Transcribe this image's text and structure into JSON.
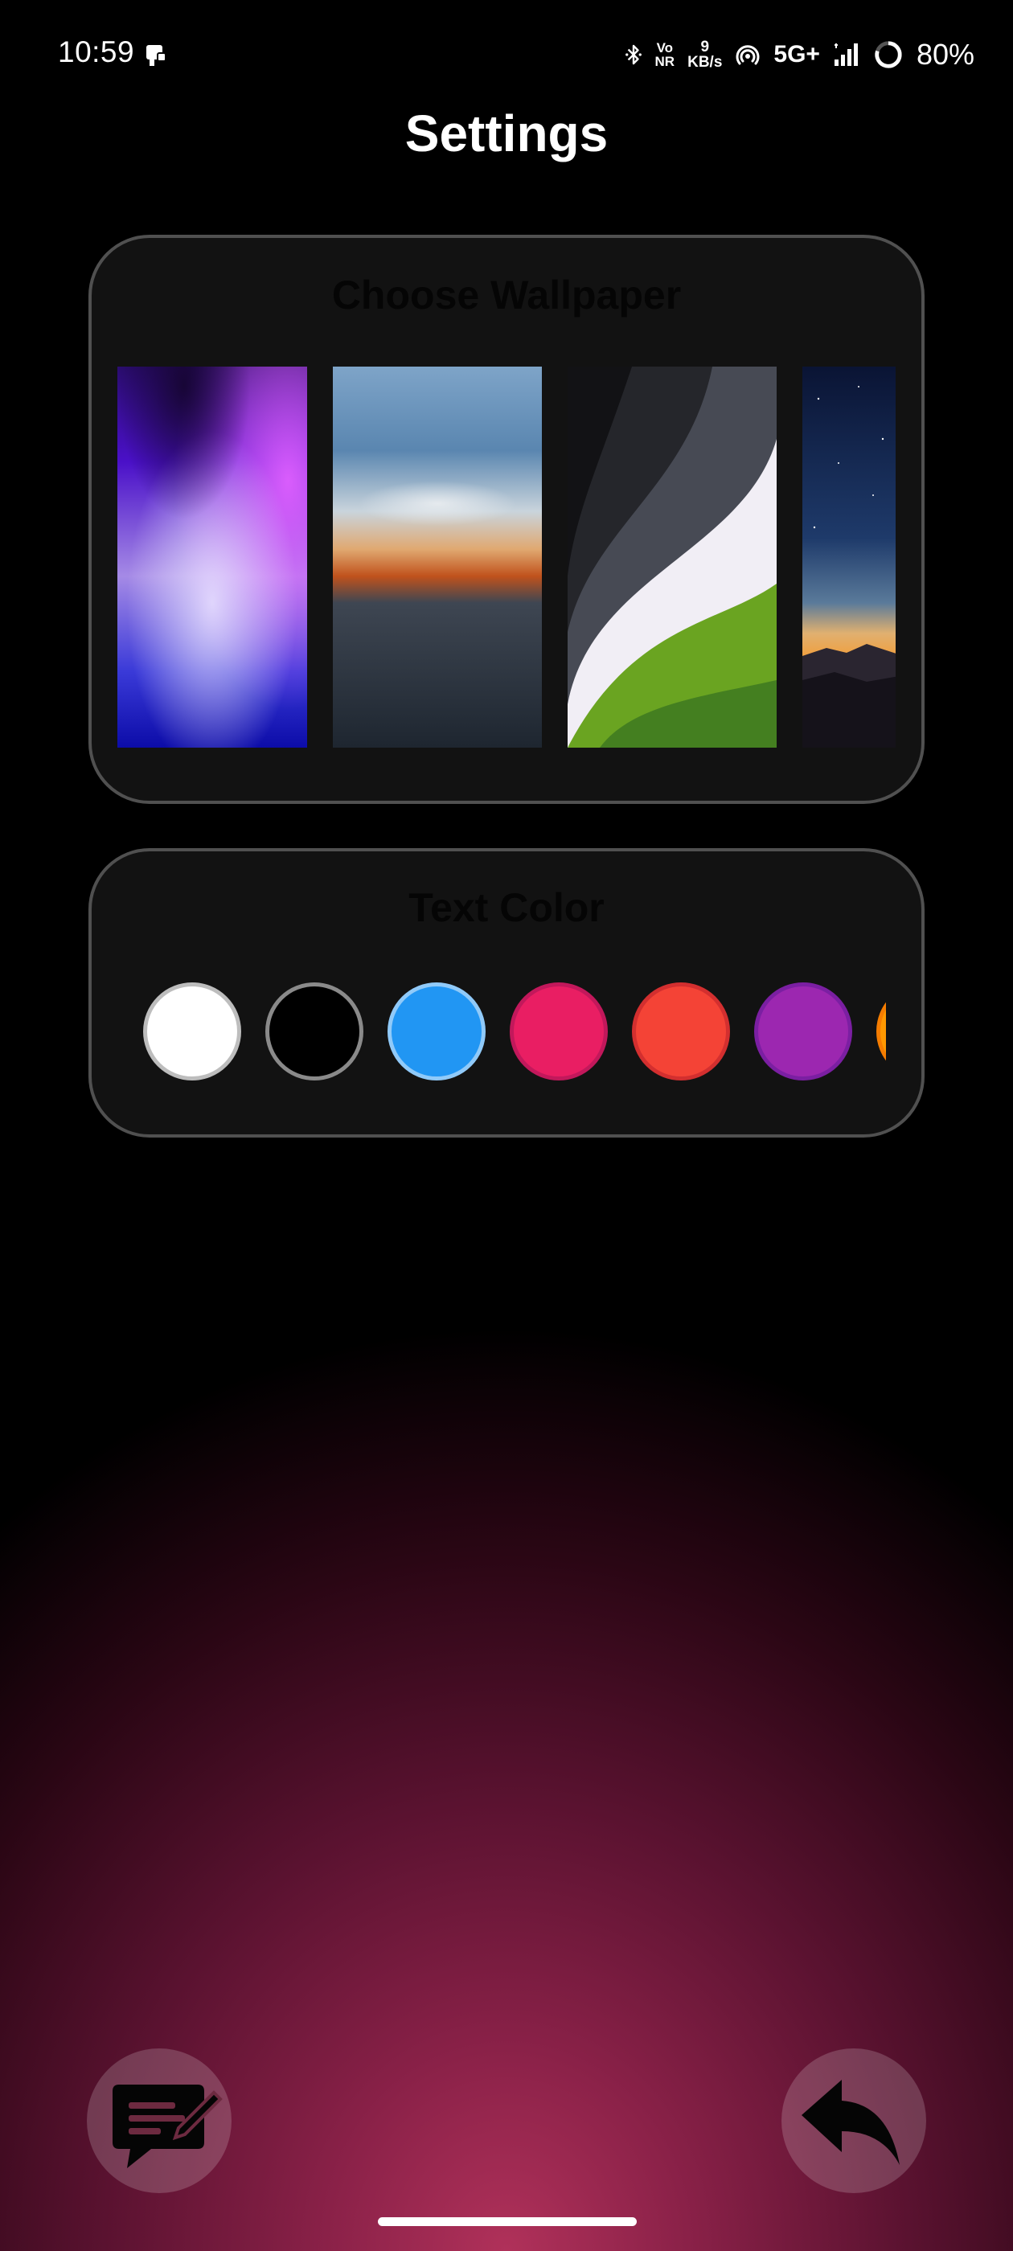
{
  "status_bar": {
    "time": "10:59",
    "network_speed_value": "9",
    "network_speed_unit": "KB/s",
    "volte_top": "Vo",
    "volte_bottom": "NR",
    "network_type": "5G+",
    "battery": "80%",
    "icons": [
      "notification-app-icon",
      "bluetooth-icon",
      "vonr-icon",
      "network-speed-icon",
      "hotspot-icon",
      "5g-icon",
      "signal-icon",
      "battery-icon"
    ]
  },
  "title": "Settings",
  "wallpaper_section": {
    "title": "Choose Wallpaper",
    "wallpapers": [
      {
        "name": "purple-gradient"
      },
      {
        "name": "cloudy-sunset"
      },
      {
        "name": "green-waves"
      },
      {
        "name": "starry-night"
      }
    ]
  },
  "text_color_section": {
    "title": "Text Color",
    "colors": [
      {
        "name": "white",
        "hex": "#FFFFFF",
        "border": "#BDBDBD"
      },
      {
        "name": "black",
        "hex": "#000000",
        "border": "#8A8A8A"
      },
      {
        "name": "blue",
        "hex": "#2196F3",
        "border": "#90CAF9"
      },
      {
        "name": "pink",
        "hex": "#E91E63",
        "border": "#C2185B"
      },
      {
        "name": "red",
        "hex": "#F44336",
        "border": "#D32F2F"
      },
      {
        "name": "purple",
        "hex": "#9C27B0",
        "border": "#7B1FA2"
      },
      {
        "name": "orange",
        "hex": "#FF9800",
        "border": "#F57C00"
      }
    ]
  },
  "fabs": {
    "left_icon": "edit-note-icon",
    "right_icon": "back-arrow-icon"
  },
  "colors": {
    "card_background": "#121212",
    "card_border": "#505050",
    "background_glow": "#B0315A"
  }
}
